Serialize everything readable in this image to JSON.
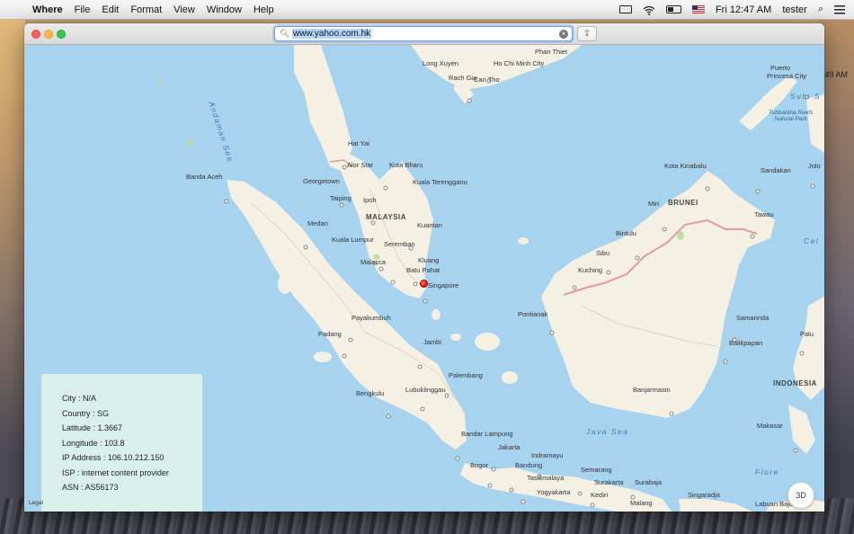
{
  "menubar": {
    "apple_glyph": "",
    "app_name": "Where",
    "menus": [
      "File",
      "Edit",
      "Format",
      "View",
      "Window",
      "Help"
    ],
    "clock": "Fri 12:47 AM",
    "user": "tester"
  },
  "desktop": {
    "clock_peek": "49 AM"
  },
  "window": {
    "url": "www.yahoo.com.hk",
    "share_glyph": "⇪",
    "clear_glyph": "×"
  },
  "map": {
    "countries": [
      "MALAYSIA",
      "BRUNEI",
      "INDONESIA"
    ],
    "seas": [
      "Andaman Sea",
      "Java Sea",
      "Sulu S",
      "Flore",
      "Cel"
    ],
    "reef": [
      "Tubbataha Reefs",
      "Natural Park"
    ],
    "cities": {
      "phan_thiet": "Phan Thiet",
      "long_xuyen": "Long Xuyen",
      "ho_chi_minh": "Ho Chi Minh City",
      "rach_gia": "Rach Gia",
      "can_tho": "Can Tho",
      "puerto_princesa_1": "Puerto",
      "puerto_princesa_2": "Princesa City",
      "hat_yai": "Hat Yai",
      "kota_bharu": "Kota Bharu",
      "alor_star": "Alor Star",
      "georgetown": "Georgetown",
      "kuala_terengganu": "Kuala Terengganu",
      "taiping": "Taiping",
      "ipoh": "Ipoh",
      "banda_aceh": "Banda Aceh",
      "medan": "Medan",
      "kuantan": "Kuantan",
      "kuala_lumpur": "Kuala Lumpur",
      "seremban": "Seremban",
      "malacca": "Malacca",
      "kluang": "Kluang",
      "batu_pahat": "Batu Pahat",
      "singapore": "Singapore",
      "kota_kinabalu": "Kota Kinabalu",
      "sandakan": "Sandakan",
      "jolo": "Jolo",
      "miri": "Miri",
      "tawau": "Tawau",
      "bintulu": "Bintulu",
      "sibu": "Sibu",
      "kuching": "Kuching",
      "pontianak": "Pontianak",
      "samarinda": "Samarinda",
      "balikpapan": "Balikpapan",
      "palu": "Palu",
      "payakumbuh": "Payakumbuh",
      "padang": "Padang",
      "jambi": "Jambi",
      "palembang": "Palembang",
      "bengkulu": "Bengkulu",
      "lubuklinggau": "Lubuklinggau",
      "banjarmasin": "Banjarmasin",
      "makasar": "Makasar",
      "bandar_lampung": "Bandar Lampung",
      "jakarta": "Jakarta",
      "indramayu": "Indramayu",
      "bogor": "Bogor",
      "bandung": "Bandung",
      "tasikmalaya": "Tasikmalaya",
      "semarang": "Semarang",
      "surakarta": "Surakarta",
      "surabaja": "Surabaja",
      "yogyakarta": "Yogyakarta",
      "kediri": "Kediri",
      "malang": "Malang",
      "singaradja": "Singaradja",
      "labuan_bajo": "Labuan Bajo"
    },
    "legal": "Legal",
    "compass_label": "3D",
    "zoom_out": "−",
    "zoom_in": "+"
  },
  "info": {
    "city": "City : N/A",
    "country": "Country : SG",
    "latitude": "Latitude : 1.3667",
    "longitude": "Longitude : 103.8",
    "ip": "IP Address : 106.10.212.150",
    "isp": "ISP :  internet content provider",
    "asn": "ASN : AS56173"
  },
  "colors": {
    "water": "#a7d3ee",
    "land": "#f4f0e4",
    "border": "#e59a9a",
    "pin": "#e0120a"
  }
}
